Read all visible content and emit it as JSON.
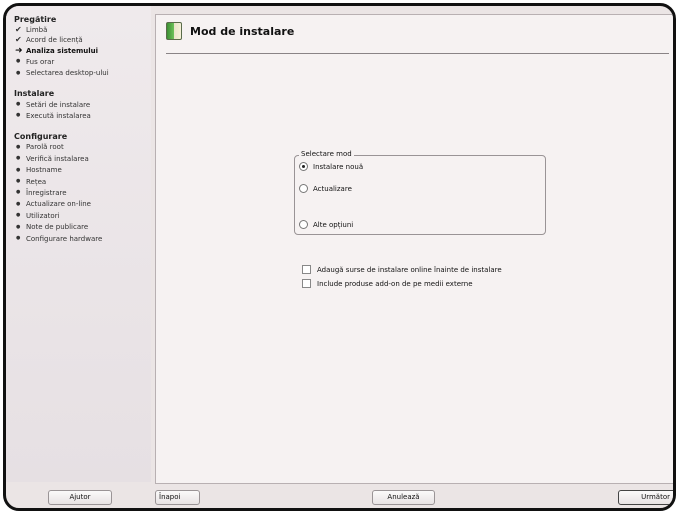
{
  "sidebar": {
    "sections": [
      {
        "heading": "Pregătire",
        "items": [
          {
            "label": "Limbă",
            "mark": "check"
          },
          {
            "label": "Acord de licență",
            "mark": "check"
          },
          {
            "label": "Analiza sistemului",
            "mark": "arrow",
            "current": true
          },
          {
            "label": "Fus orar",
            "mark": "bullet"
          },
          {
            "label": "Selectarea desktop-ului",
            "mark": "bullet"
          }
        ]
      },
      {
        "heading": "Instalare",
        "items": [
          {
            "label": "Setări de instalare",
            "mark": "bullet"
          },
          {
            "label": "Execută instalarea",
            "mark": "bullet"
          }
        ]
      },
      {
        "heading": "Configurare",
        "items": [
          {
            "label": "Parolă root",
            "mark": "bullet"
          },
          {
            "label": "Verifică instalarea",
            "mark": "bullet"
          },
          {
            "label": "Hostname",
            "mark": "bullet"
          },
          {
            "label": "Rețea",
            "mark": "bullet"
          },
          {
            "label": "Înregistrare",
            "mark": "bullet"
          },
          {
            "label": "Actualizare on-line",
            "mark": "bullet"
          },
          {
            "label": "Utilizatori",
            "mark": "bullet"
          },
          {
            "label": "Note de publicare",
            "mark": "bullet"
          },
          {
            "label": "Configurare hardware",
            "mark": "bullet"
          }
        ]
      }
    ]
  },
  "main": {
    "title": "Mod de instalare",
    "mode_group": {
      "legend": "Selectare mod",
      "options": [
        {
          "label": "Instalare nouă",
          "checked": true
        },
        {
          "label": "Actualizare",
          "checked": false
        },
        {
          "label": "Alte opțiuni",
          "checked": false
        }
      ]
    },
    "checkboxes": [
      {
        "label": "Adaugă surse de instalare online înainte de instalare",
        "checked": false
      },
      {
        "label": "Include produse add-on de pe medii externe",
        "checked": false
      }
    ]
  },
  "buttons": {
    "help": "Ajutor",
    "back": "Înapoi",
    "abort": "Anulează",
    "next": "Următor"
  }
}
